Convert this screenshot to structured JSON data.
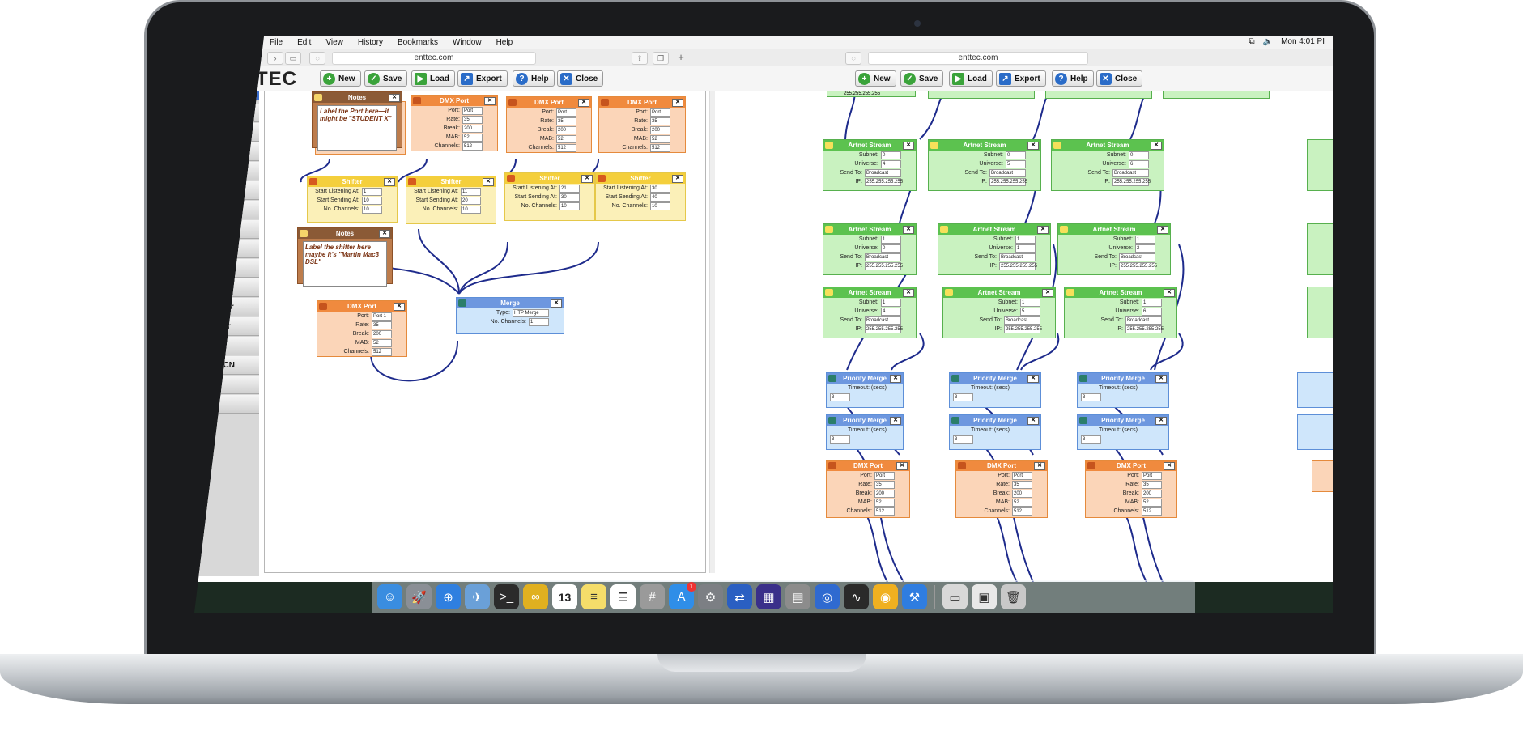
{
  "menubar": {
    "items": [
      "File",
      "Edit",
      "View",
      "History",
      "Bookmarks",
      "Window",
      "Help"
    ],
    "clock": "Mon 4:01 PI"
  },
  "left": {
    "url": "enttec.com",
    "brand": "TEC",
    "toolbar": {
      "new": "New",
      "save": "Save",
      "load": "Load",
      "export": "Export",
      "help": "Help",
      "close": "Close"
    },
    "sidebar": [
      "Port",
      "tream",
      "Stream",
      "",
      "",
      "y Merge",
      "her 1-2",
      "her 2-1",
      "Generator",
      "-PRO",
      "Senerator",
      "npressor",
      "",
      "ming ACN",
      "",
      ""
    ],
    "notes1": {
      "title": "Notes",
      "text": "Label the Port here—it might be \"STUDENT X\""
    },
    "notes2": {
      "title": "Notes",
      "text": "Label the shifter here maybe it's \"Martin Mac3 DSL\""
    },
    "notes_partial_label": "Channels:",
    "notes_partial_value": "512",
    "dmx_ports": [
      {
        "title": "DMX Port",
        "port": "Port",
        "rate": "35",
        "brk": "200",
        "mab": "52",
        "ch": "512"
      },
      {
        "title": "DMX Port",
        "port": "Port",
        "rate": "35",
        "brk": "200",
        "mab": "52",
        "ch": "512"
      },
      {
        "title": "DMX Port",
        "port": "Port",
        "rate": "35",
        "brk": "200",
        "mab": "52",
        "ch": "512"
      },
      {
        "title": "DMX Port",
        "port": "Port 1",
        "rate": "35",
        "brk": "200",
        "mab": "52",
        "ch": "512"
      }
    ],
    "shifters": [
      {
        "title": "Shifter",
        "listen": "1",
        "send": "10",
        "num": "10"
      },
      {
        "title": "Shifter",
        "listen": "11",
        "send": "20",
        "num": "10"
      },
      {
        "title": "Shifter",
        "listen": "21",
        "send": "30",
        "num": "10"
      },
      {
        "title": "Shifter",
        "listen": "30",
        "send": "40",
        "num": "10"
      }
    ],
    "merge": {
      "title": "Merge",
      "type": "HTP Merge",
      "channels": "1"
    },
    "labels": {
      "port": "Port:",
      "rate": "Rate:",
      "break": "Break:",
      "mab": "MAB:",
      "channels": "Channels:",
      "listen": "Start Listening At:",
      "send": "Start Sending At:",
      "num": "No. Channels:",
      "type": "Type:"
    }
  },
  "right": {
    "url": "enttec.com",
    "toolbar": {
      "new": "New",
      "save": "Save",
      "load": "Load",
      "export": "Export",
      "help": "Help",
      "close": "Close"
    },
    "partial_ip": "255.255.255.255",
    "artnet": [
      {
        "title": "Artnet Stream",
        "subnet": "0",
        "universe": "4",
        "send": "Broadcast",
        "ip": "255.255.255.255"
      },
      {
        "title": "Artnet Stream",
        "subnet": "0",
        "universe": "5",
        "send": "Broadcast",
        "ip": "255.255.255.255"
      },
      {
        "title": "Artnet Stream",
        "subnet": "0",
        "universe": "6",
        "send": "Broadcast",
        "ip": "255.255.255.255"
      },
      {
        "title": "Artnet Stream",
        "subnet": "1",
        "universe": "0",
        "send": "Broadcast",
        "ip": "255.255.255.255"
      },
      {
        "title": "Artnet Stream",
        "subnet": "1",
        "universe": "1",
        "send": "Broadcast",
        "ip": "255.255.255.255"
      },
      {
        "title": "Artnet Stream",
        "subnet": "1",
        "universe": "2",
        "send": "Broadcast",
        "ip": "255.255.255.255"
      },
      {
        "title": "Artnet Stream",
        "subnet": "1",
        "universe": "4",
        "send": "Broadcast",
        "ip": "255.255.255.255"
      },
      {
        "title": "Artnet Stream",
        "subnet": "1",
        "universe": "5",
        "send": "Broadcast",
        "ip": "255.255.255.255"
      },
      {
        "title": "Artnet Stream",
        "subnet": "1",
        "universe": "6",
        "send": "Broadcast",
        "ip": "255.255.255.255"
      }
    ],
    "labels": {
      "subnet": "Subnet:",
      "universe": "Universe:",
      "sendto": "Send To:",
      "ip": "IP:",
      "timeout": "Timeout: (secs)",
      "port": "Port:",
      "rate": "Rate:",
      "break": "Break:",
      "mab": "MAB:",
      "channels": "Channels:"
    },
    "merges": [
      {
        "title": "Priority Merge",
        "timeout": "3"
      },
      {
        "title": "Priority Merge",
        "timeout": "3"
      },
      {
        "title": "Priority Merge",
        "timeout": "3"
      },
      {
        "title": "Priority Merge",
        "timeout": "3"
      },
      {
        "title": "Priority Merge",
        "timeout": "3"
      },
      {
        "title": "Priority Merge",
        "timeout": "3"
      }
    ],
    "dmx": [
      {
        "title": "DMX Port",
        "port": "Port",
        "rate": "35",
        "brk": "200",
        "mab": "52",
        "ch": "512"
      },
      {
        "title": "DMX Port",
        "port": "Port",
        "rate": "35",
        "brk": "200",
        "mab": "52",
        "ch": "512"
      },
      {
        "title": "DMX Port",
        "port": "Port",
        "rate": "35",
        "brk": "200",
        "mab": "52",
        "ch": "512"
      }
    ]
  },
  "dock": {
    "calendar_day": "13",
    "appstore_badge": "1",
    "apps": [
      "finder-icon",
      "launchpad-icon",
      "safari-icon",
      "preview-icon",
      "terminal-icon",
      "wire-icon",
      "calendar-icon",
      "notes-icon",
      "reminders-icon",
      "calculator-icon",
      "app-store-icon",
      "system-preferences-icon",
      "xtransfer-icon",
      "midi-icon",
      "router-icon",
      "gateway-icon",
      "activity-monitor-icon",
      "chrome-icon",
      "xcode-icon",
      "documents-icon",
      "desktop-icon",
      "trash-icon"
    ]
  }
}
